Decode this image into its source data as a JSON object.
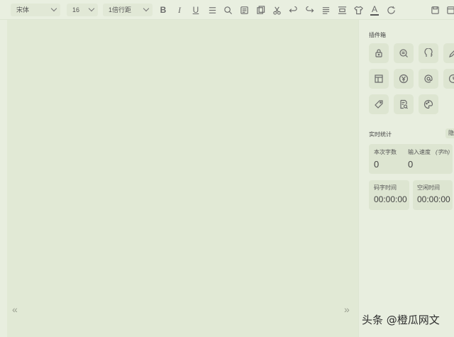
{
  "toolbar": {
    "font_family": "宋体",
    "font_size": "16",
    "line_spacing": "1倍行距",
    "icons": [
      "bold-icon",
      "italic-icon",
      "underline-icon",
      "strikethrough-icon",
      "search-icon",
      "document-icon",
      "copy-icon",
      "cut-icon",
      "undo-icon",
      "redo-icon",
      "align-icon",
      "indent-icon",
      "shirt-icon",
      "font-color-icon",
      "refresh-icon",
      "save-icon",
      "window-icon"
    ],
    "bold": "B",
    "italic": "I",
    "underline": "U",
    "font_color": "A"
  },
  "editor": {
    "prev_arrow": "«",
    "next_arrow": "»"
  },
  "panel": {
    "plugins_title": "插件箱",
    "plugins": [
      "lock-icon",
      "search-doc-icon",
      "head-icon",
      "pencil-icon",
      "table-icon",
      "yen-icon",
      "at-icon",
      "clock-icon",
      "tag-icon",
      "document-search-icon",
      "palette-icon"
    ],
    "stats_title": "实时统计",
    "stats_tag": "隐",
    "stats": {
      "session_words_label": "本次字数",
      "session_words_value": "0",
      "input_speed_label": "输入速度",
      "input_speed_unit": "(字/h)",
      "input_speed_value": "0",
      "typing_time_label": "码字时间",
      "typing_time_value": "00:00:00",
      "idle_time_label": "空闲时间",
      "idle_time_value": "00:00:00"
    }
  },
  "watermark": "头条 @橙瓜网文"
}
